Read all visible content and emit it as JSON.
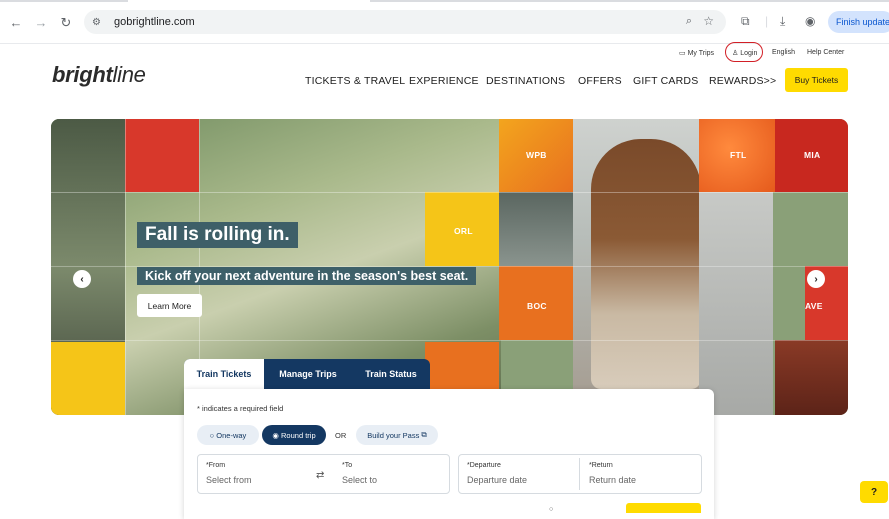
{
  "browser": {
    "url": "gobrightline.com",
    "finish_update": "Finish update"
  },
  "utility_nav": {
    "my_trips": "My Trips",
    "login": "Login",
    "language": "English",
    "help_center": "Help Center"
  },
  "logo": {
    "bold": "bright",
    "light": "line"
  },
  "main_nav": {
    "items": [
      "TICKETS & TRAVEL",
      "EXPERIENCE",
      "DESTINATIONS",
      "OFFERS",
      "GIFT CARDS",
      "REWARDS>>"
    ],
    "buy_tickets": "Buy Tickets"
  },
  "hero": {
    "title": "Fall is rolling in.",
    "subtitle": "Kick off your next adventure in the season's best seat.",
    "learn_more": "Learn More",
    "station_tiles": [
      "WPB",
      "ORL",
      "BOC",
      "FTL",
      "MIA",
      "AVE"
    ]
  },
  "booking": {
    "tabs": [
      "Train Tickets",
      "Manage Trips",
      "Train Status"
    ],
    "active_tab": "Train Tickets",
    "required_note": "* indicates a required field",
    "trip_types": {
      "one_way": "One-way",
      "round_trip": "Round trip",
      "selected": "Round trip"
    },
    "or_text": "OR",
    "build_pass": "Build your Pass",
    "fields": {
      "from_label": "*From",
      "from_placeholder": "Select from",
      "to_label": "*To",
      "to_placeholder": "Select to",
      "departure_label": "*Departure",
      "departure_placeholder": "Departure date",
      "return_label": "*Return",
      "return_placeholder": "Return date"
    }
  },
  "colors": {
    "brand_yellow": "#ffdb00",
    "nav_blue": "#143862",
    "hero_teal": "#3e5f68",
    "tile_red": "#d8382b",
    "tile_orange": "#e8701f"
  }
}
